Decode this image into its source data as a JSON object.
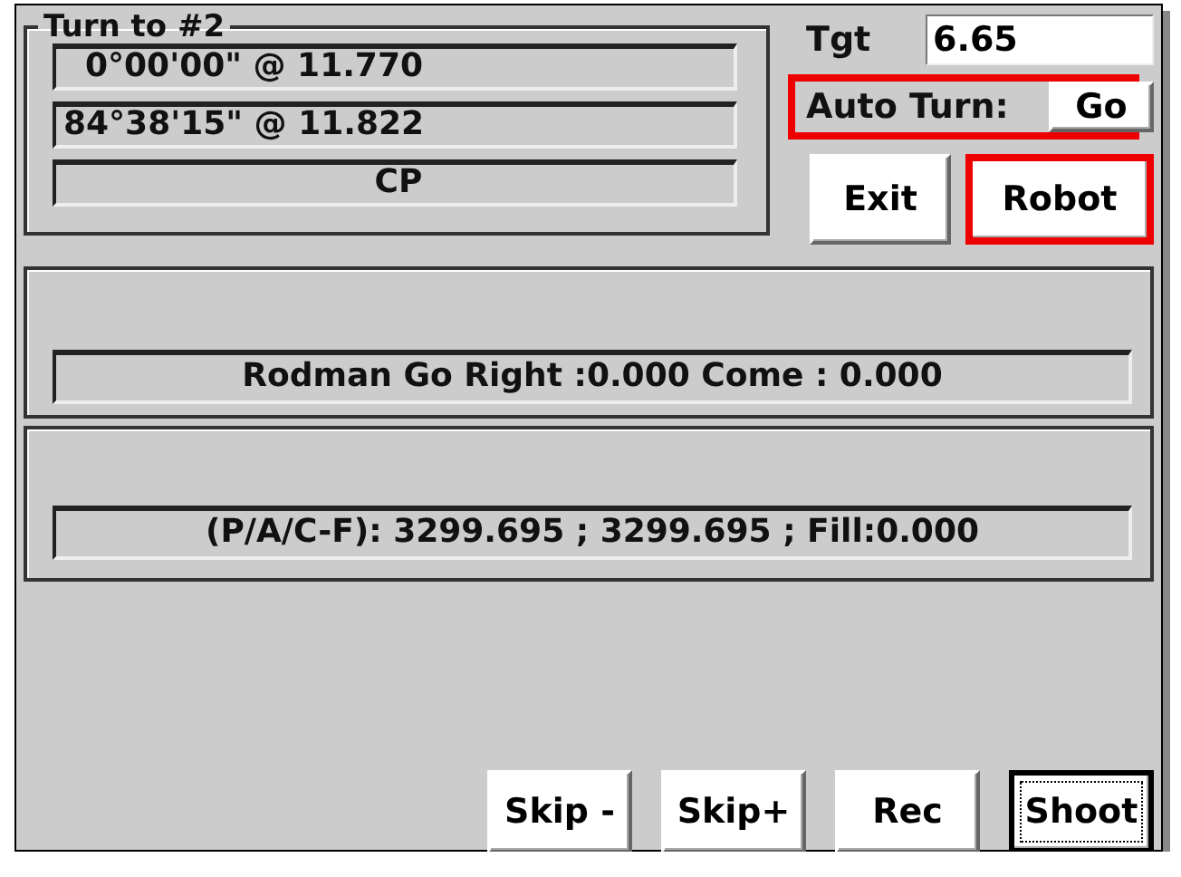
{
  "turn_group": {
    "title": "Turn to #2",
    "fields": [
      "0°00'00\" @ 11.770",
      "84°38'15\" @ 11.822",
      "CP"
    ]
  },
  "target": {
    "label": "Tgt",
    "value": "6.65"
  },
  "auto_turn": {
    "label": "Auto Turn:",
    "button": "Go",
    "highlighted": true
  },
  "top_buttons": [
    {
      "label": "Exit",
      "highlighted": false
    },
    {
      "label": "Robot",
      "highlighted": true
    }
  ],
  "status_panels": [
    "Rodman Go Right :0.000  Come  : 0.000",
    "(P/A/C-F): 3299.695 ; 3299.695 ; Fill:0.000"
  ],
  "bottom_buttons": [
    {
      "label": "Skip -",
      "focused": false
    },
    {
      "label": "Skip+",
      "focused": false
    },
    {
      "label": "Rec",
      "focused": false
    },
    {
      "label": "Shoot",
      "focused": true
    }
  ]
}
